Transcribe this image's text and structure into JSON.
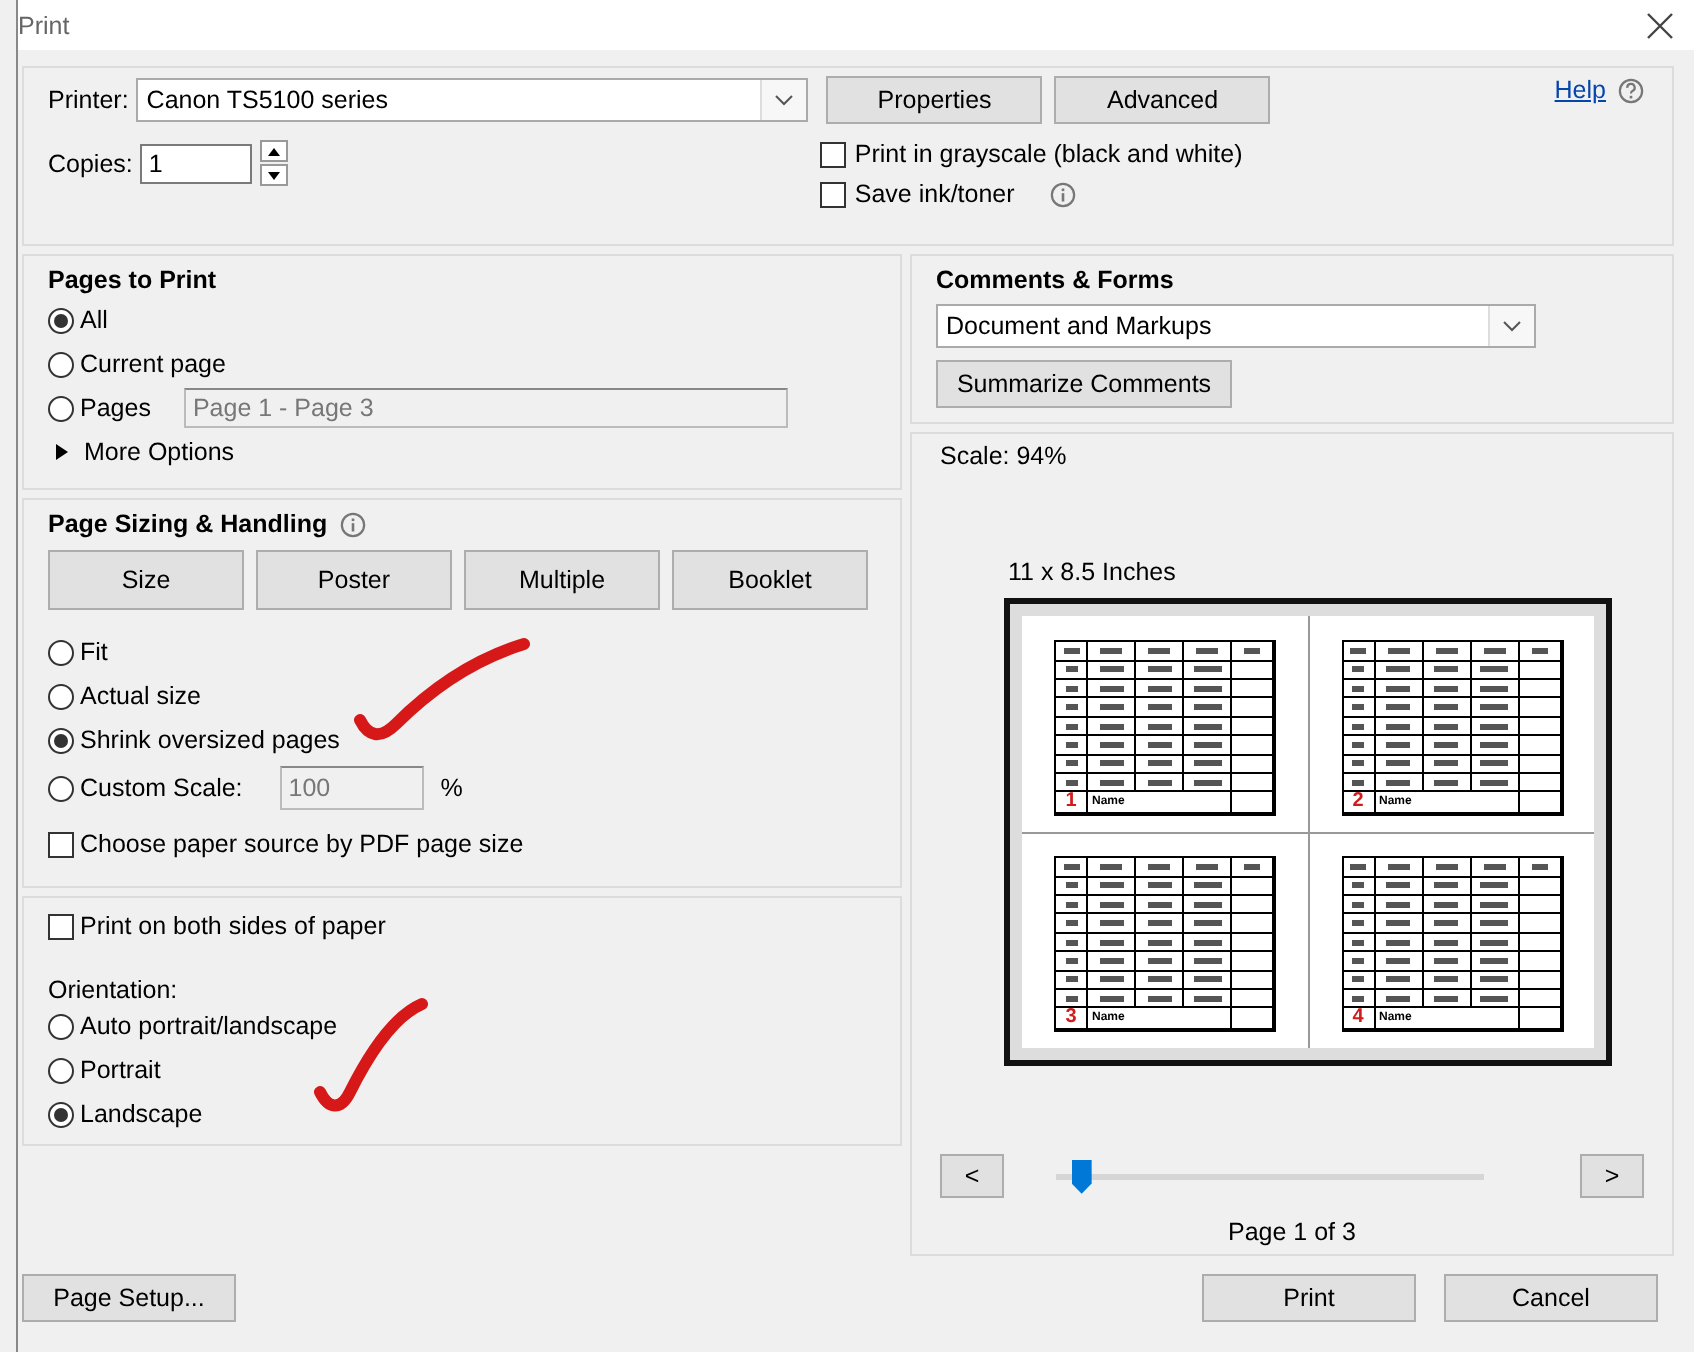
{
  "window": {
    "title": "Print"
  },
  "printer": {
    "label": "Printer:",
    "value": "Canon TS5100 series"
  },
  "top_buttons": [
    "Properties",
    "Advanced"
  ],
  "help": {
    "label": "Help"
  },
  "copies": {
    "label": "Copies:",
    "value": "1"
  },
  "print_options": [
    {
      "label": "Print in grayscale (black and white)",
      "checked": false,
      "info": false
    },
    {
      "label": "Save ink/toner",
      "checked": false,
      "info": true
    }
  ],
  "pages_to_print": {
    "title": "Pages to Print",
    "options": [
      {
        "label": "All",
        "selected": true
      },
      {
        "label": "Current page",
        "selected": false
      },
      {
        "label": "Pages",
        "selected": false,
        "field_value": "Page 1 - Page 3"
      }
    ],
    "more_options": "More Options"
  },
  "sizing": {
    "title": "Page Sizing & Handling",
    "modes": [
      "Size",
      "Poster",
      "Multiple",
      "Booklet"
    ],
    "options": [
      {
        "label": "Fit",
        "selected": false
      },
      {
        "label": "Actual size",
        "selected": false
      },
      {
        "label": "Shrink oversized pages",
        "selected": true
      },
      {
        "label": "Custom Scale:",
        "selected": false,
        "field_value": "100",
        "unit": "%"
      }
    ],
    "paper_source": {
      "label": "Choose paper source by PDF page size",
      "checked": false
    }
  },
  "duplex": {
    "label": "Print on both sides of paper",
    "checked": false
  },
  "orientation": {
    "title": "Orientation:",
    "options": [
      {
        "label": "Auto portrait/landscape",
        "selected": false
      },
      {
        "label": "Portrait",
        "selected": false
      },
      {
        "label": "Landscape",
        "selected": true
      }
    ]
  },
  "comments": {
    "title": "Comments & Forms",
    "value": "Document and Markups",
    "button": "Summarize Comments"
  },
  "preview": {
    "scale": "Scale:  94%",
    "paper": "11 x 8.5 Inches",
    "pages": [
      {
        "number": "1",
        "name": "Name"
      },
      {
        "number": "2",
        "name": "Name"
      },
      {
        "number": "3",
        "name": "Name"
      },
      {
        "number": "4",
        "name": "Name"
      }
    ],
    "prev": "<",
    "next": ">",
    "level": 0.06,
    "page_label": "Page 1 of 3"
  },
  "footer": {
    "page_setup": "Page Setup...",
    "print": "Print",
    "cancel": "Cancel"
  }
}
